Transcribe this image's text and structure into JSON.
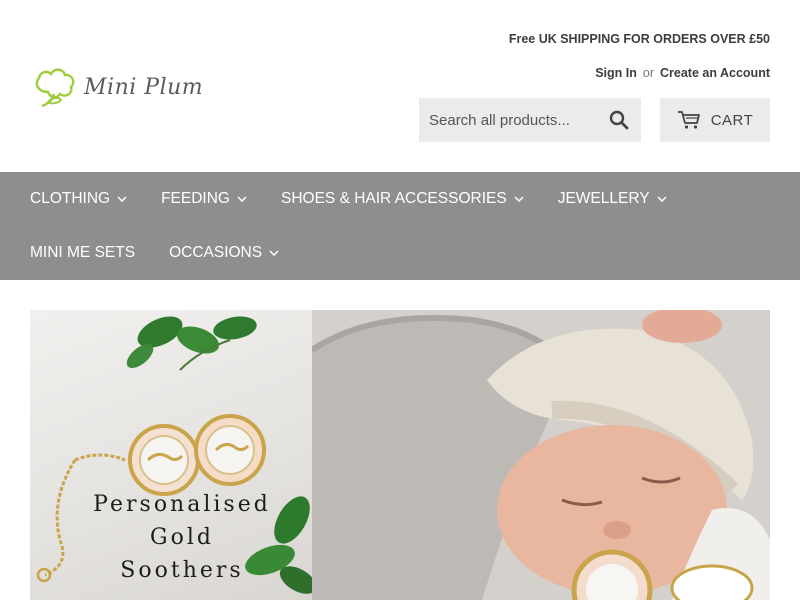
{
  "brand": {
    "name": "Mini Plum"
  },
  "header": {
    "promo": "Free UK SHIPPING FOR ORDERS OVER £50",
    "sign_in": "Sign In",
    "or": "or",
    "create_account": "Create an Account",
    "search": {
      "placeholder": "Search all products...",
      "icon": "search-icon"
    },
    "cart": {
      "label": "CART",
      "icon": "cart-icon"
    }
  },
  "nav": {
    "row1": [
      {
        "label": "CLOTHING",
        "has_dropdown": true
      },
      {
        "label": "FEEDING",
        "has_dropdown": true
      },
      {
        "label": "SHOES & HAIR ACCESSORIES",
        "has_dropdown": true
      },
      {
        "label": "JEWELLERY",
        "has_dropdown": true
      }
    ],
    "row2": [
      {
        "label": "MINI ME SETS",
        "has_dropdown": false
      },
      {
        "label": "OCCASIONS",
        "has_dropdown": true
      }
    ]
  },
  "banner": {
    "caption_line1": "Personalised",
    "caption_line2": "Gold",
    "caption_line3": "Soothers"
  },
  "colors": {
    "nav_bg": "#8e8e8c",
    "search_bg": "#ebebeb",
    "logo_green": "#9ccd3a",
    "text_dark": "#3d3d3d"
  }
}
